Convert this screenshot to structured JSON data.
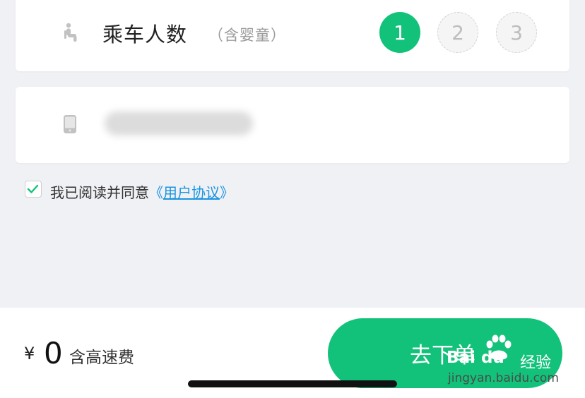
{
  "passengers": {
    "title": "乘车人数",
    "subtitle": "（含婴童）",
    "options": [
      {
        "label": "1",
        "selected": true
      },
      {
        "label": "2",
        "selected": false
      },
      {
        "label": "3",
        "selected": false
      }
    ],
    "icon": "seat-icon"
  },
  "phone": {
    "icon": "phone-icon",
    "value_obscured": true
  },
  "agreement": {
    "checked": true,
    "text": "我已阅读并同意",
    "link_open": "《",
    "link_text": "用户协议",
    "link_close": "》"
  },
  "footer": {
    "currency": "¥",
    "price": "0",
    "note": "含高速费",
    "button_label": "去下单"
  },
  "watermark": {
    "brand": "Bai du",
    "sub": "经验",
    "url": "jingyan.baidu.com"
  },
  "colors": {
    "accent": "#13c27a",
    "link": "#1b95e0",
    "background": "#f0f1f5"
  }
}
